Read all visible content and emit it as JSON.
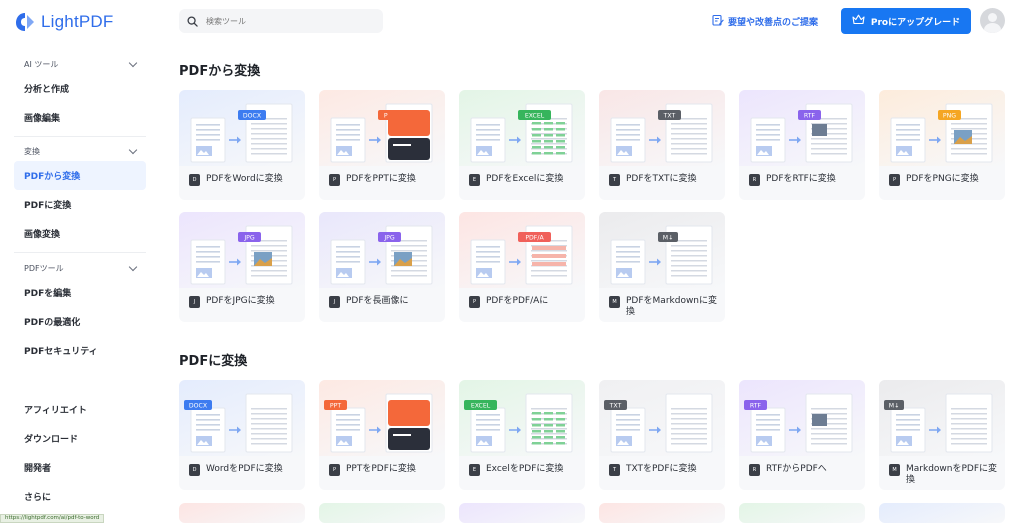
{
  "app": {
    "name": "LightPDF",
    "brand_color": "#2f6dea",
    "status_url": "https://lightpdf.com/ai/pdf-to-word"
  },
  "search": {
    "placeholder": "検索ツール",
    "icon": "search-icon"
  },
  "header": {
    "feedback_label": "要望や改善点のご提案",
    "feedback_icon": "edit-note-icon",
    "upgrade_label": "Proにアップグレード",
    "upgrade_icon": "crown-icon"
  },
  "sidebar": {
    "sections": [
      {
        "title": "AI ツール",
        "items": [
          {
            "label": "分析と作成"
          },
          {
            "label": "画像編集"
          }
        ]
      },
      {
        "title": "変換",
        "items": [
          {
            "label": "PDFから変換",
            "active": true
          },
          {
            "label": "PDFに変換"
          },
          {
            "label": "画像変換"
          }
        ]
      },
      {
        "title": "PDFツール",
        "items": [
          {
            "label": "PDFを編集"
          },
          {
            "label": "PDFの最適化"
          },
          {
            "label": "PDFセキュリティ"
          }
        ]
      }
    ],
    "bottom": [
      {
        "label": "アフィリエイト"
      },
      {
        "label": "ダウンロード"
      },
      {
        "label": "開発者"
      },
      {
        "label": "さらに"
      }
    ]
  },
  "from_pdf": {
    "title": "PDFから変換",
    "tools": [
      {
        "label": "PDFをWordに変換",
        "badge": "DOCX",
        "color": "#3d7cf0",
        "bg": "#e4ecfd"
      },
      {
        "label": "PDFをPPTに変換",
        "badge": "PPT",
        "color": "#f4683a",
        "bg": "#fde9e3"
      },
      {
        "label": "PDFをExcelに変換",
        "badge": "EXCEL",
        "color": "#36b55c",
        "bg": "#e3f5e6"
      },
      {
        "label": "PDFをTXTに変換",
        "badge": "TXT",
        "color": "#5b5f66",
        "bg": "#f9e6e6"
      },
      {
        "label": "PDFをRTFに変換",
        "badge": "RTF",
        "color": "#8a63ec",
        "bg": "#ece5fd"
      },
      {
        "label": "PDFをPNGに変換",
        "badge": "PNG",
        "color": "#f5a623",
        "bg": "#fdecdc"
      },
      {
        "label": "PDFをJPGに変換",
        "badge": "JPG",
        "color": "#8a63ec",
        "bg": "#ece5fd"
      },
      {
        "label": "PDFを長画像に",
        "badge": "JPG",
        "color": "#8a63ec",
        "bg": "#e9e7fb"
      },
      {
        "label": "PDFをPDF/Aに",
        "badge": "PDF/A",
        "color": "#f0605a",
        "bg": "#fde5e3"
      },
      {
        "label": "PDFをMarkdownに変換",
        "badge": "M↓",
        "color": "#5b5f66",
        "bg": "#ebebed"
      }
    ]
  },
  "to_pdf": {
    "title": "PDFに変換",
    "tools": [
      {
        "label": "WordをPDFに変換",
        "badge": "DOCX",
        "color": "#3d7cf0",
        "bg": "#e4ecfd"
      },
      {
        "label": "PPTをPDFに変換",
        "badge": "PPT",
        "color": "#f4683a",
        "bg": "#fde9e3"
      },
      {
        "label": "ExcelをPDFに変換",
        "badge": "EXCEL",
        "color": "#36b55c",
        "bg": "#e3f5e6"
      },
      {
        "label": "TXTをPDFに変換",
        "badge": "TXT",
        "color": "#5b5f66",
        "bg": "#f0f0f2"
      },
      {
        "label": "RTFからPDFへ",
        "badge": "RTF",
        "color": "#8a63ec",
        "bg": "#ece5fd"
      },
      {
        "label": "MarkdownをPDFに変換",
        "badge": "M↓",
        "color": "#5b5f66",
        "bg": "#ebebed"
      }
    ]
  }
}
